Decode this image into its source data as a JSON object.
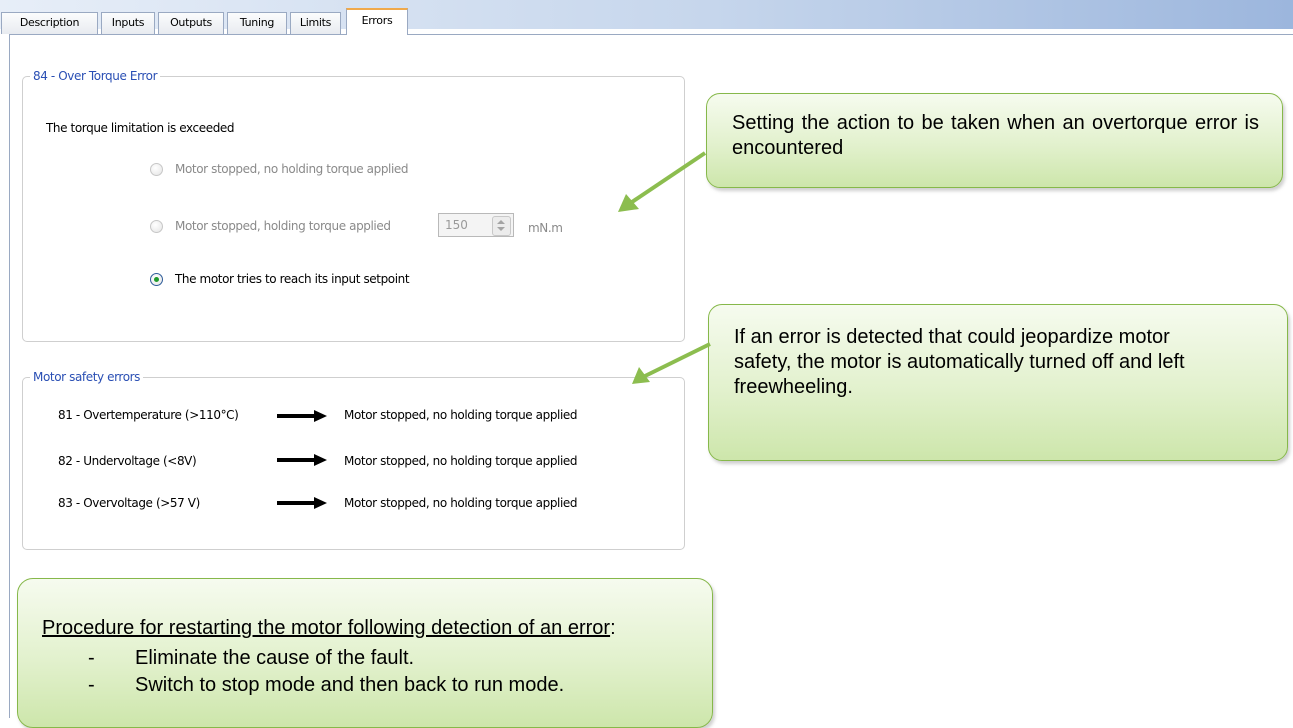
{
  "tabs": [
    "Description",
    "Inputs",
    "Outputs",
    "Tuning",
    "Limits",
    "Errors"
  ],
  "active_tab": "Errors",
  "over_torque": {
    "title": "84 - Over Torque Error",
    "description": "The torque limitation is exceeded",
    "options": [
      {
        "label": "Motor stopped, no holding torque applied",
        "selected": false,
        "enabled": false
      },
      {
        "label": "Motor stopped, holding torque applied",
        "selected": false,
        "enabled": false
      },
      {
        "label": "The motor tries to reach its input setpoint",
        "selected": true,
        "enabled": true
      }
    ],
    "holding_torque_value": "150",
    "holding_torque_unit": "mN.m"
  },
  "safety": {
    "title": "Motor safety errors",
    "rows": [
      {
        "error": "81 - Overtemperature (>110°C)",
        "action": "Motor stopped, no holding torque applied"
      },
      {
        "error": "82 - Undervoltage (<8V)",
        "action": "Motor stopped, no holding torque applied"
      },
      {
        "error": "83 - Overvoltage (>57 V)",
        "action": "Motor stopped, no holding torque applied"
      }
    ]
  },
  "callouts": {
    "overtorque": "Setting the action to be taken when an overtorque error is encountered",
    "safety": "If an error is detected that could jeopardize motor safety, the motor is automatically turned off and left freewheeling.",
    "procedure_title": "Procedure for restarting the motor following detection of an error",
    "procedure_suffix": ":",
    "procedure_steps": [
      "Eliminate the cause of the fault.",
      "Switch to stop mode and then back to run mode."
    ],
    "bullet": "-"
  },
  "colors": {
    "group_title": "#2a4fb4",
    "callout_fill": "#e2f1cd",
    "callout_border": "#86b84a",
    "callout_arrow": "#8cbd4f",
    "active_tab_accent": "#f0a94b",
    "radio_selected": "#1f9a2c"
  }
}
